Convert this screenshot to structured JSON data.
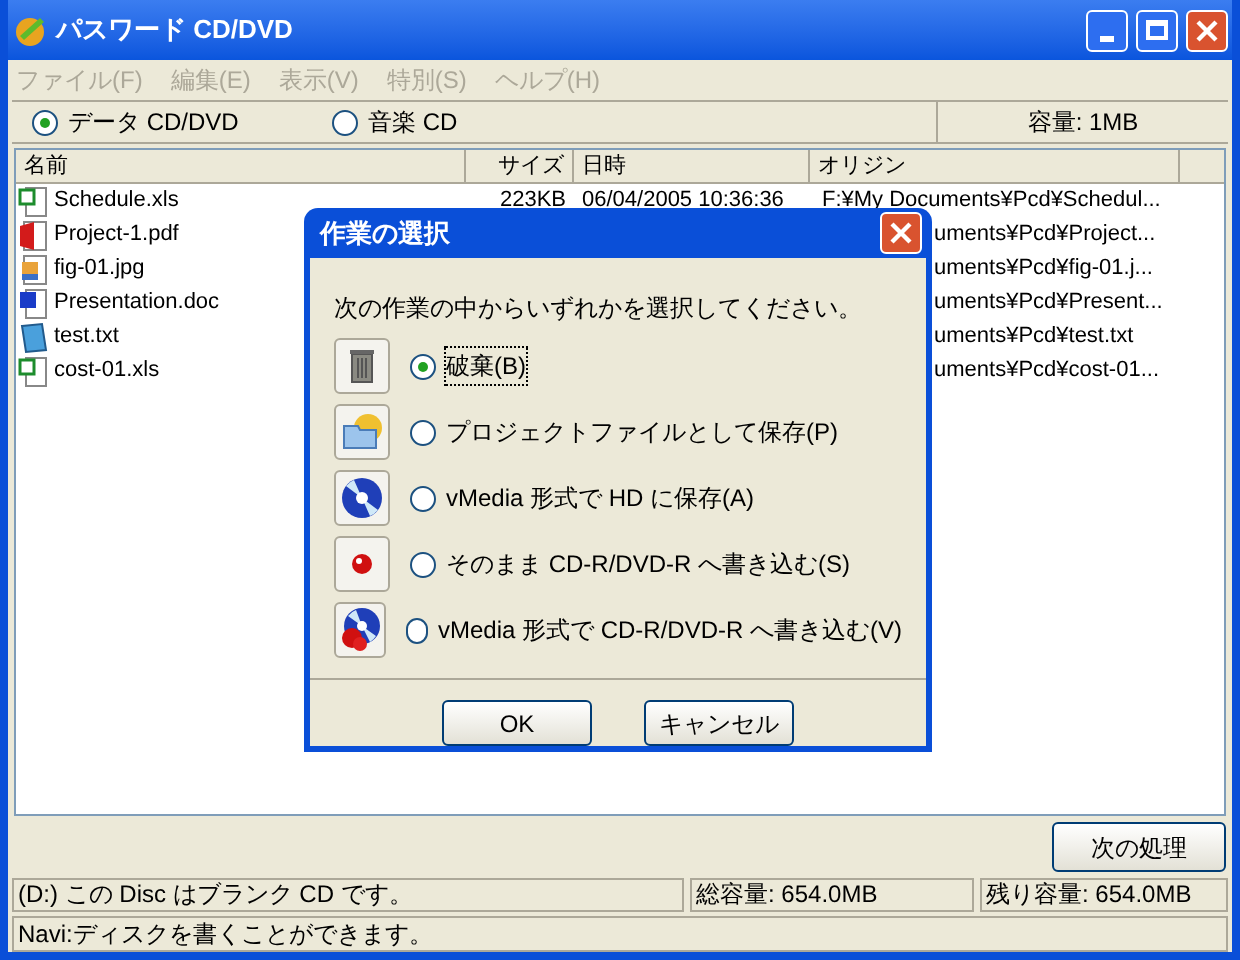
{
  "window": {
    "title": "パスワード CD/DVD"
  },
  "menu": [
    {
      "label": "ファイル(F)",
      "disabled": true
    },
    {
      "label": "編集(E)",
      "disabled": true
    },
    {
      "label": "表示(V)",
      "disabled": true
    },
    {
      "label": "特別(S)",
      "disabled": true
    },
    {
      "label": "ヘルプ(H)",
      "disabled": true
    }
  ],
  "disc_types": [
    {
      "label": "データ CD/DVD",
      "selected": true
    },
    {
      "label": "音楽 CD",
      "selected": false
    }
  ],
  "capacity": "容量: 1MB",
  "table": {
    "columns": [
      "名前",
      "サイズ",
      "日時",
      "オリジン"
    ],
    "rows": [
      {
        "kind": "xls",
        "name": "Schedule.xls",
        "size": "223KB",
        "date": "06/04/2005 10:36:36",
        "origin": "F:¥My Documents¥Pcd¥Schedul...",
        "covered": false
      },
      {
        "kind": "pdf",
        "name": "Project-1.pdf",
        "origin": "uments¥Pcd¥Project...",
        "covered": true
      },
      {
        "kind": "jpg",
        "name": "fig-01.jpg",
        "origin": "uments¥Pcd¥fig-01.j...",
        "covered": true
      },
      {
        "kind": "doc",
        "name": "Presentation.doc",
        "origin": "uments¥Pcd¥Present...",
        "covered": true
      },
      {
        "kind": "txt",
        "name": "test.txt",
        "origin": "uments¥Pcd¥test.txt",
        "covered": true
      },
      {
        "kind": "xls",
        "name": "cost-01.xls",
        "origin": "uments¥Pcd¥cost-01...",
        "covered": true
      }
    ]
  },
  "next_button": "次の処理",
  "status_bar": [
    "(D:) この Disc はブランク CD です。",
    "総容量: 654.0MB",
    "残り容量: 654.0MB"
  ],
  "navi": "Navi:ディスクを書くことができます。",
  "dialog": {
    "title": "作業の選択",
    "prompt": "次の作業の中からいずれかを選択してください。",
    "options": [
      {
        "kind": "trash",
        "label": "破棄(B)",
        "selected": true
      },
      {
        "kind": "folder",
        "label": "プロジェクトファイルとして保存(P)",
        "selected": false
      },
      {
        "kind": "disc",
        "label": "vMedia 形式で HD に保存(A)",
        "selected": false
      },
      {
        "kind": "ball",
        "label": "そのまま CD-R/DVD-R へ書き込む(S)",
        "selected": false
      },
      {
        "kind": "discball",
        "label": "vMedia 形式で CD-R/DVD-R へ書き込む(V)",
        "selected": false
      }
    ],
    "buttons": [
      "OK",
      "キャンセル"
    ]
  }
}
